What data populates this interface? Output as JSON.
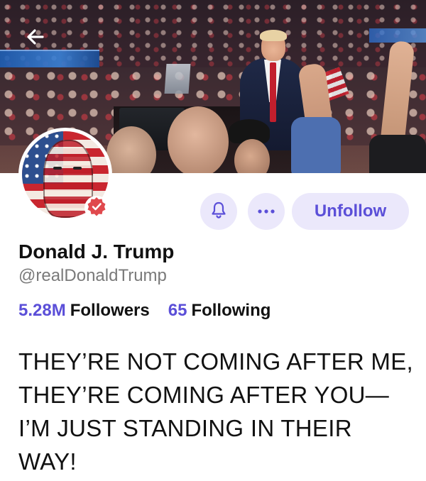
{
  "banner": {
    "back_icon": "arrow-left-icon"
  },
  "avatar": {
    "verified_icon": "verified-badge-icon",
    "verified_color": "#e0494d"
  },
  "actions": {
    "bell_icon": "bell-icon",
    "more_icon": "more-horizontal-icon",
    "unfollow_label": "Unfollow"
  },
  "profile": {
    "display_name": "Donald J. Trump",
    "handle": "@realDonaldTrump",
    "followers_count": "5.28M",
    "followers_label": "Followers",
    "following_count": "65",
    "following_label": "Following",
    "bio": "THEY’RE NOT COMING AFTER ME, THEY’RE COMING AFTER YOU—I’M JUST STANDING IN THEIR WAY!"
  },
  "theme": {
    "accent": "#5b4fd8",
    "button_bg": "#ebe8fb",
    "muted_text": "#7a7a7a"
  }
}
